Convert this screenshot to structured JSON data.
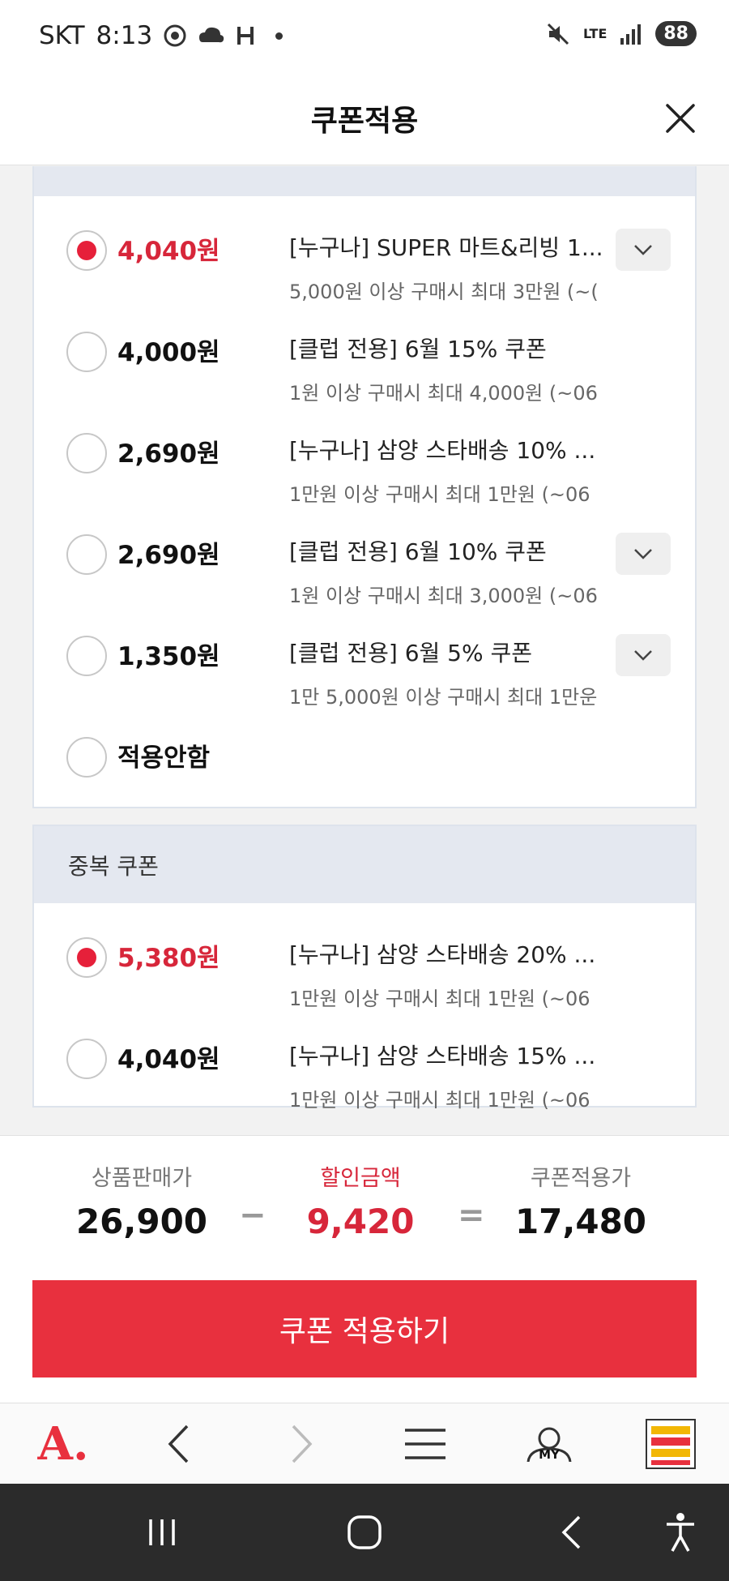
{
  "status_bar": {
    "carrier": "SKT",
    "time": "8:13",
    "network": "LTE",
    "battery": "88"
  },
  "header": {
    "title": "쿠폰적용"
  },
  "section1": {
    "coupons": [
      {
        "amount": "4,040원",
        "title": "[누구나] SUPER 마트&리빙 1...",
        "desc": "5,000원 이상 구매시 최대 3만원 (~(",
        "selected": true,
        "has_toggle": true
      },
      {
        "amount": "4,000원",
        "title": "[클럽 전용] 6월 15% 쿠폰",
        "desc": "1원 이상 구매시 최대 4,000원 (~06",
        "selected": false,
        "has_toggle": false
      },
      {
        "amount": "2,690원",
        "title": "[누구나] 삼양 스타배송 10% ...",
        "desc": "1만원 이상 구매시 최대 1만원 (~06",
        "selected": false,
        "has_toggle": false
      },
      {
        "amount": "2,690원",
        "title": "[클럽 전용] 6월 10% 쿠폰",
        "desc": "1원 이상 구매시 최대 3,000원 (~06",
        "selected": false,
        "has_toggle": true
      },
      {
        "amount": "1,350원",
        "title": "[클럽 전용] 6월 5% 쿠폰",
        "desc": "1만 5,000원 이상 구매시 최대 1만운",
        "selected": false,
        "has_toggle": true
      }
    ],
    "none_label": "적용안함"
  },
  "section2": {
    "header": "중복 쿠폰",
    "coupons": [
      {
        "amount": "5,380원",
        "title": "[누구나] 삼양 스타배송 20% ...",
        "desc": "1만원 이상 구매시 최대 1만원 (~06",
        "selected": true
      },
      {
        "amount": "4,040원",
        "title": "[누구나] 삼양 스타배송 15% ...",
        "desc": "1만원 이상 구매시 최대 1만원 (~06",
        "selected": false
      }
    ]
  },
  "summary": {
    "price_label": "상품판매가",
    "price": "26,900",
    "minus": "−",
    "discount_label": "할인금액",
    "discount": "9,420",
    "equals": "=",
    "final_label": "쿠폰적용가",
    "final": "17,480",
    "apply_button": "쿠폰 적용하기"
  },
  "toolbar": {
    "logo": "A.",
    "my_label": "MY"
  },
  "colors": {
    "accent": "#e8303e",
    "selected_text": "#d7263a"
  }
}
